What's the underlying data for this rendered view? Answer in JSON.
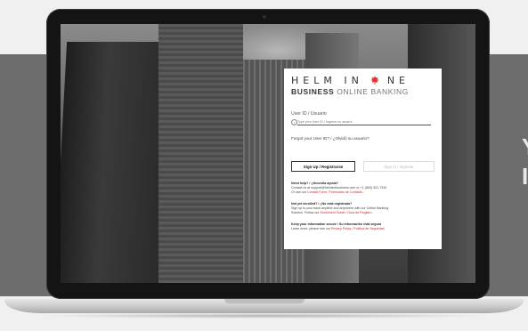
{
  "brand": {
    "text_left": "HELM IN",
    "text_right": "NE",
    "mark_color": "#e2302d"
  },
  "product": {
    "bold": "BUSINESS",
    "rest": "ONLINE BANKING"
  },
  "login": {
    "user_label": "User ID / Usuario",
    "user_placeholder": "Type your User ID / Ingrese su usuario",
    "forgot_link": "Forgot your User ID? / ¿Olvidó su usuario?",
    "signup_button": "Sign Up / Registrarse",
    "signin_button": "Sign In / Ingresar"
  },
  "help": {
    "need_help": {
      "heading": "Need help? / ¿Necesita ayuda?",
      "line1": "Contact us at support@helminebusiness.com or +1 (800) 321-7332",
      "line2_prefix": "Or use our",
      "line2_link": "Contact Form / Formulario de Contacto",
      "line2_suffix": "."
    },
    "not_enrolled": {
      "heading": "Not yet enrolled? / ¿No está registrado?",
      "line1": "Sign up to your bank anytime and anywhere with our Online Banking",
      "line2_prefix": "Solution. Follow our",
      "line2_link": "Enrollment Guide / Guía de Registro",
      "line2_suffix": "."
    },
    "secure": {
      "heading": "Keep your information secure / Su información está segura",
      "line1_prefix": "Learn more, please see our",
      "line1_link": "Privacy Policy / Política de Seguridad",
      "line1_suffix": "."
    }
  },
  "colors": {
    "accent": "#c8262e",
    "band": "#6d6d6d",
    "lid": "#141414"
  }
}
